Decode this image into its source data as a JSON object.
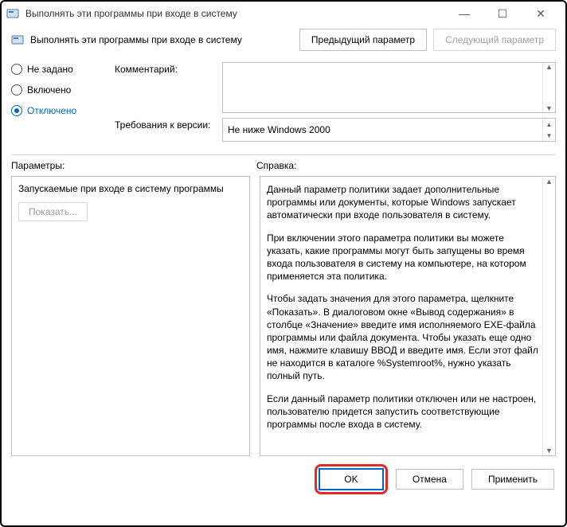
{
  "window": {
    "title": "Выполнять эти программы при входе в систему"
  },
  "header": {
    "policy_title": "Выполнять эти программы при входе в систему",
    "prev": "Предыдущий параметр",
    "next": "Следующий параметр"
  },
  "state": {
    "not_configured": "Не задано",
    "enabled": "Включено",
    "disabled": "Отключено"
  },
  "fields": {
    "comment_label": "Комментарий:",
    "requirement_label": "Требования к версии:",
    "requirement_value": "Не ниже Windows 2000"
  },
  "sections": {
    "options_label": "Параметры:",
    "help_label": "Справка:"
  },
  "options": {
    "title": "Запускаемые при входе в систему программы",
    "show_button": "Показать..."
  },
  "help": {
    "p1": "Данный параметр политики задает дополнительные программы или документы, которые Windows запускает автоматически при входе пользователя в систему.",
    "p2": "При включении этого параметра политики вы можете указать, какие программы могут быть запущены во время входа пользователя в систему на компьютере, на котором применяется эта политика.",
    "p3": "Чтобы задать значения для этого параметра, щелкните «Показать». В диалоговом окне «Вывод содержания» в столбце «Значение» введите имя исполняемого EXE-файла программы или файла документа. Чтобы указать еще одно имя, нажмите клавишу ВВОД и введите имя. Если этот файл не находится в каталоге %Systemroot%, нужно указать полный путь.",
    "p4": "Если данный параметр политики отключен или не настроен, пользователю придется запустить соответствующие программы после входа в систему."
  },
  "footer": {
    "ok": "OK",
    "cancel": "Отмена",
    "apply": "Применить"
  }
}
